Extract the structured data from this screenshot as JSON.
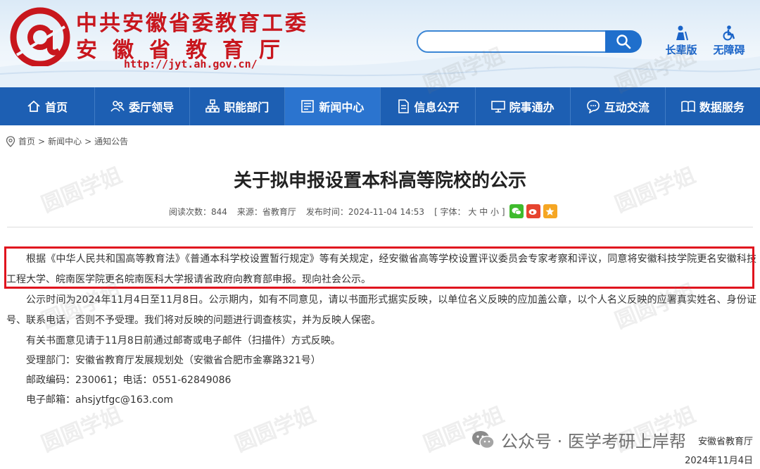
{
  "header": {
    "title_line1": "中共安徽省委教育工委",
    "title_line2": "安徽省教育厅",
    "url": "http://jyt.ah.gov.cn/",
    "search_placeholder": "",
    "elder_label": "长辈版",
    "accessible_label": "无障碍"
  },
  "nav": [
    {
      "label": "首页",
      "icon": "home-icon"
    },
    {
      "label": "委厅领导",
      "icon": "people-icon"
    },
    {
      "label": "职能部门",
      "icon": "org-chart-icon"
    },
    {
      "label": "新闻中心",
      "icon": "news-icon",
      "active": true
    },
    {
      "label": "信息公开",
      "icon": "document-icon"
    },
    {
      "label": "院事通办",
      "icon": "monitor-icon"
    },
    {
      "label": "互动交流",
      "icon": "chat-icon"
    },
    {
      "label": "数据服务",
      "icon": "book-icon"
    }
  ],
  "breadcrumb": [
    "首页",
    ">",
    "新闻中心",
    ">",
    "通知公告"
  ],
  "article": {
    "title": "关于拟申报设置本科高等院校的公示",
    "meta": {
      "views": "阅读次数：844",
      "source": "来源：省教育厅",
      "time": "发布时间：2024-11-04 14:53",
      "font": "[ 字体： 大  中  小 ]"
    },
    "paragraphs": [
      "根据《中华人民共和国高等教育法》《普通本科学校设置暂行规定》等有关规定，经安徽省高等学校设置评议委员会专家考察和评议，同意将安徽科技学院更名安徽科技工程大学、皖南医学院更名皖南医科大学报请省政府向教育部申报。现向社会公示。",
      "公示时间为2024年11月4日至11月8日。公示期内，如有不同意见，请以书面形式据实反映，以单位名义反映的应加盖公章，以个人名义反映的应署真实姓名、身份证号、联系电话，否则不予受理。我们将对反映的问题进行调查核实，并为反映人保密。",
      "有关书面意见请于11月8日前通过邮寄或电子邮件（扫描件）方式反映。",
      "受理部门：安徽省教育厅发展规划处（安徽省合肥市金寨路321号）",
      "邮政编码：230061；电话：0551-62849086",
      "电子邮箱：ahsjytfgc@163.com"
    ],
    "signature": "安徽省教育厅",
    "date": "2024年11月4日"
  },
  "overlay": {
    "wechat_text": "公众号 · 医学考研上岸帮",
    "watermark": "圆圆学姐"
  },
  "colors": {
    "brand_red": "#c8161d",
    "nav_blue": "#1d5fb3",
    "highlight_red": "#e0141e"
  }
}
